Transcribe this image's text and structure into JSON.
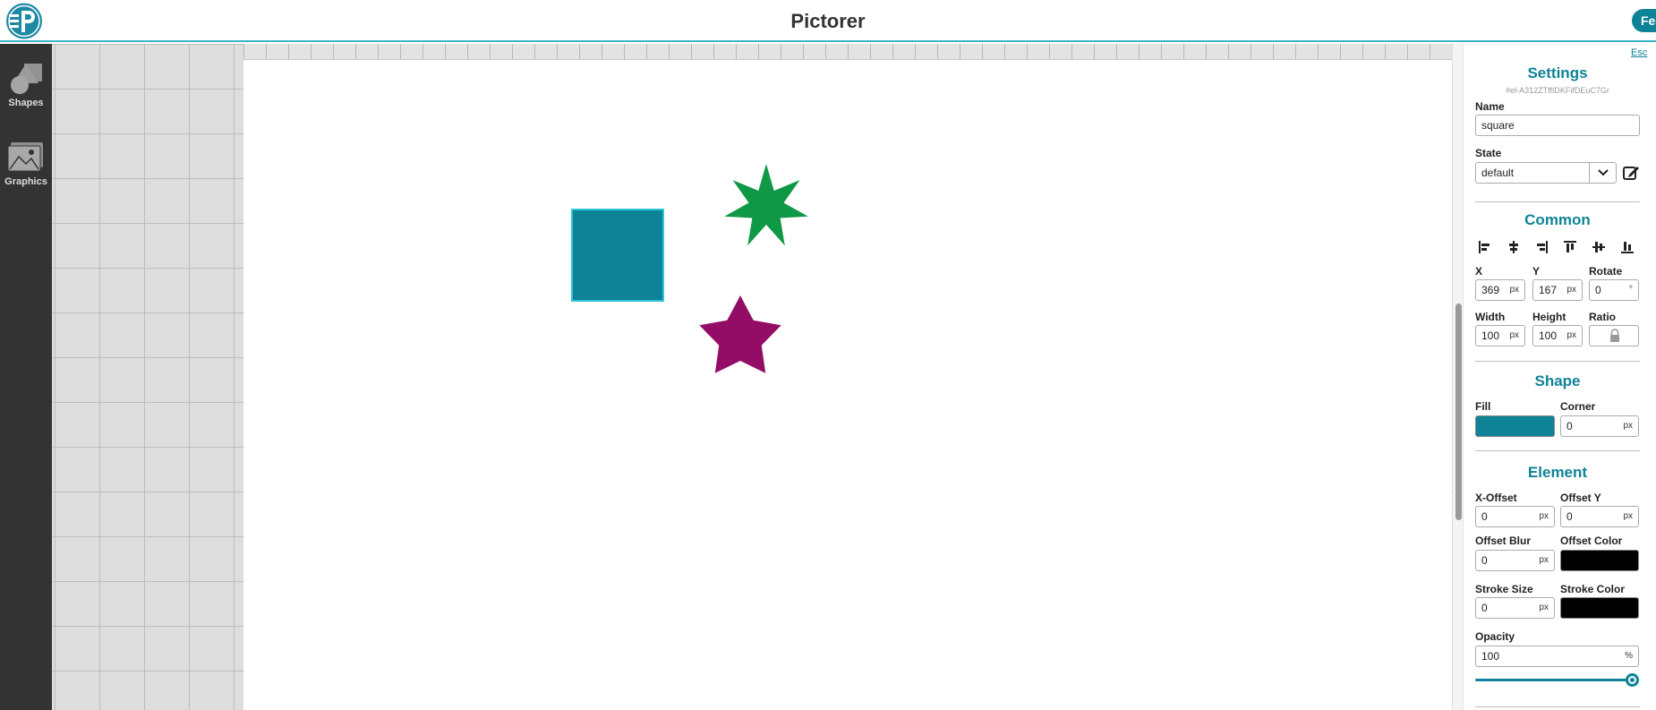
{
  "app": {
    "title": "Pictorer",
    "feedback_label": "Fe"
  },
  "toolbar": {
    "items": [
      {
        "label": "Shapes",
        "icon": "shapes-icon"
      },
      {
        "label": "Graphics",
        "icon": "graphics-icon"
      }
    ]
  },
  "canvas": {
    "shapes": [
      {
        "name": "square",
        "color": "#0e8398"
      },
      {
        "name": "star-7-point",
        "color": "#0f9845"
      },
      {
        "name": "star-5-point",
        "color": "#930d67"
      }
    ]
  },
  "panel": {
    "esc_label": "Esc",
    "settings": {
      "title": "Settings",
      "element_id": "#el-A312ZTffIDKFifDEuC7Gr",
      "name_label": "Name",
      "name_value": "square",
      "state_label": "State",
      "state_value": "default"
    },
    "common": {
      "title": "Common",
      "x_label": "X",
      "x_value": "369",
      "y_label": "Y",
      "y_value": "167",
      "rotate_label": "Rotate",
      "rotate_value": "0",
      "width_label": "Width",
      "width_value": "100",
      "height_label": "Height",
      "height_value": "100",
      "ratio_label": "Ratio",
      "unit_px": "px",
      "unit_deg": "°"
    },
    "shape": {
      "title": "Shape",
      "fill_label": "Fill",
      "fill_color": "#0e8398",
      "corner_label": "Corner",
      "corner_value": "0"
    },
    "element": {
      "title": "Element",
      "x_offset_label": "X-Offset",
      "x_offset_value": "0",
      "offset_y_label": "Offset Y",
      "offset_y_value": "0",
      "offset_blur_label": "Offset Blur",
      "offset_blur_value": "0",
      "offset_color_label": "Offset Color",
      "offset_color": "#000000",
      "stroke_size_label": "Stroke Size",
      "stroke_size_value": "0",
      "stroke_color_label": "Stroke Color",
      "stroke_color": "#000000",
      "opacity_label": "Opacity",
      "opacity_value": "100",
      "opacity_unit": "%"
    }
  }
}
